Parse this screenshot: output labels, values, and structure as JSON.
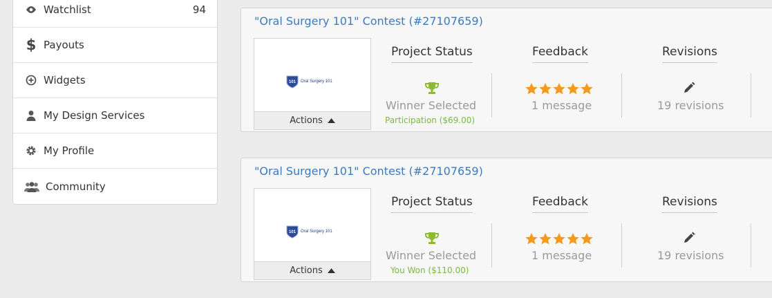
{
  "sidebar": {
    "items": [
      {
        "label": "Watchlist",
        "count": "94",
        "icon": "eye-icon"
      },
      {
        "label": "Payouts",
        "icon": "dollar-icon"
      },
      {
        "label": "Widgets",
        "icon": "plus-circle-icon"
      },
      {
        "label": "My Design Services",
        "icon": "user-icon"
      },
      {
        "label": "My Profile",
        "icon": "gear-icon"
      },
      {
        "label": "Community",
        "icon": "users-icon"
      }
    ]
  },
  "contests": [
    {
      "title": "\"Oral Surgery 101\" Contest (#27107659)",
      "logo_text": "Oral Surgery 101",
      "actions_label": "Actions",
      "status_heading": "Project Status",
      "status_value": "Winner Selected",
      "status_sub": "Participation ($69.00)",
      "feedback_heading": "Feedback",
      "feedback_value": "1 message",
      "feedback_rating": 5,
      "revisions_heading": "Revisions",
      "revisions_value": "19 revisions"
    },
    {
      "title": "\"Oral Surgery 101\" Contest (#27107659)",
      "logo_text": "Oral Surgery 101",
      "actions_label": "Actions",
      "status_heading": "Project Status",
      "status_value": "Winner Selected",
      "status_sub": "You Won ($110.00)",
      "feedback_heading": "Feedback",
      "feedback_value": "1 message",
      "feedback_rating": 5,
      "revisions_heading": "Revisions",
      "revisions_value": "19 revisions"
    }
  ],
  "colors": {
    "link": "#3a7bbf",
    "success": "#7ab83f",
    "trophy": "#8dbb2d",
    "star": "#f39a1c"
  }
}
